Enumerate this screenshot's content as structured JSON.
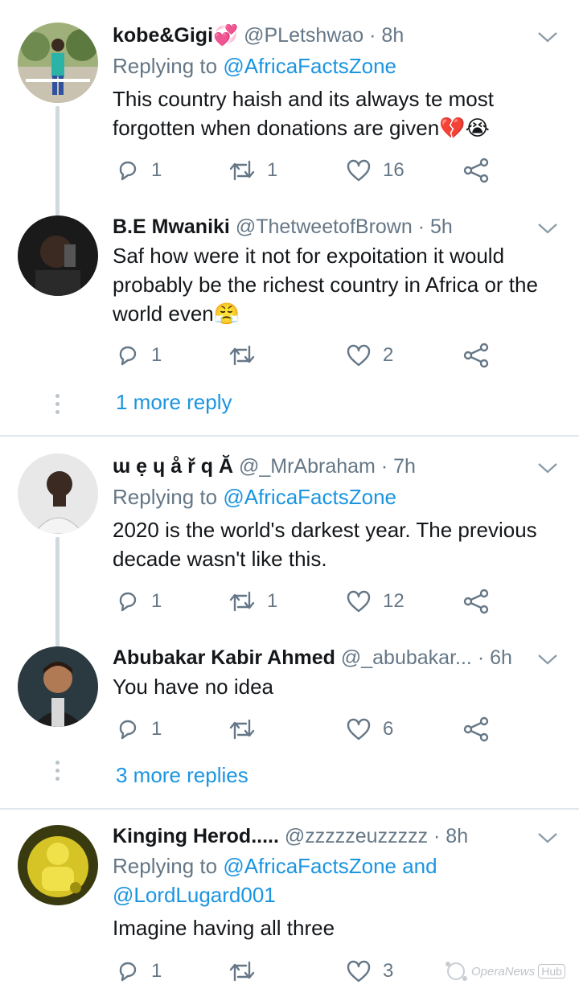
{
  "tweets": [
    {
      "name": "kobe&Gigi",
      "name_emoji": "💞",
      "handle": "@PLetshwao",
      "time": "· 8h",
      "replying_label": "Replying to",
      "replying_to": "@AfricaFactsZone",
      "text_lines": [
        "This country haish and its always te most",
        "forgotten when donations are given💔😭"
      ],
      "replies": "1",
      "retweets": "1",
      "likes": "16"
    },
    {
      "name": "B.E Mwaniki",
      "handle": "@ThetweetofBrown",
      "time": "· 5h",
      "text_lines": [
        "Saf how were it not for expoitation it would",
        "probably be the richest country in Africa or the",
        "world even😤"
      ],
      "replies": "1",
      "retweets": "",
      "likes": "2",
      "more_replies": "1 more reply"
    },
    {
      "name": "ɯ ẹ ɥ å ř q Ă",
      "handle": "@_MrAbraham",
      "time": "· 7h",
      "replying_label": "Replying to",
      "replying_to": "@AfricaFactsZone",
      "text_lines": [
        "2020 is the world's darkest year. The previous",
        "decade wasn't like this."
      ],
      "replies": "1",
      "retweets": "1",
      "likes": "12"
    },
    {
      "name": "Abubakar Kabir Ahmed",
      "handle": "@_abubakar...",
      "time": "· 6h",
      "text_lines": [
        "You have no idea"
      ],
      "replies": "1",
      "retweets": "",
      "likes": "6",
      "more_replies": "3 more replies"
    },
    {
      "name": "Kinging Herod.....",
      "handle": "@zzzzzeuzzzzz",
      "time": "· 8h",
      "replying_label": "Replying to",
      "replying_to": "@AfricaFactsZone and",
      "replying_to_2": "@LordLugard001",
      "text_lines": [
        "Imagine having all three"
      ],
      "replies": "1",
      "retweets": "",
      "likes": "3"
    }
  ],
  "watermark": {
    "text": "OperaNews",
    "badge": "Hub"
  },
  "icons": {
    "reply": "reply-icon",
    "retweet": "retweet-icon",
    "like": "heart-icon",
    "share": "share-icon",
    "more": "chevron-down-icon"
  },
  "colors": {
    "link": "#1b95e0",
    "muted": "#657786",
    "divider": "#e1e8ed",
    "thread": "#cfd9de"
  }
}
